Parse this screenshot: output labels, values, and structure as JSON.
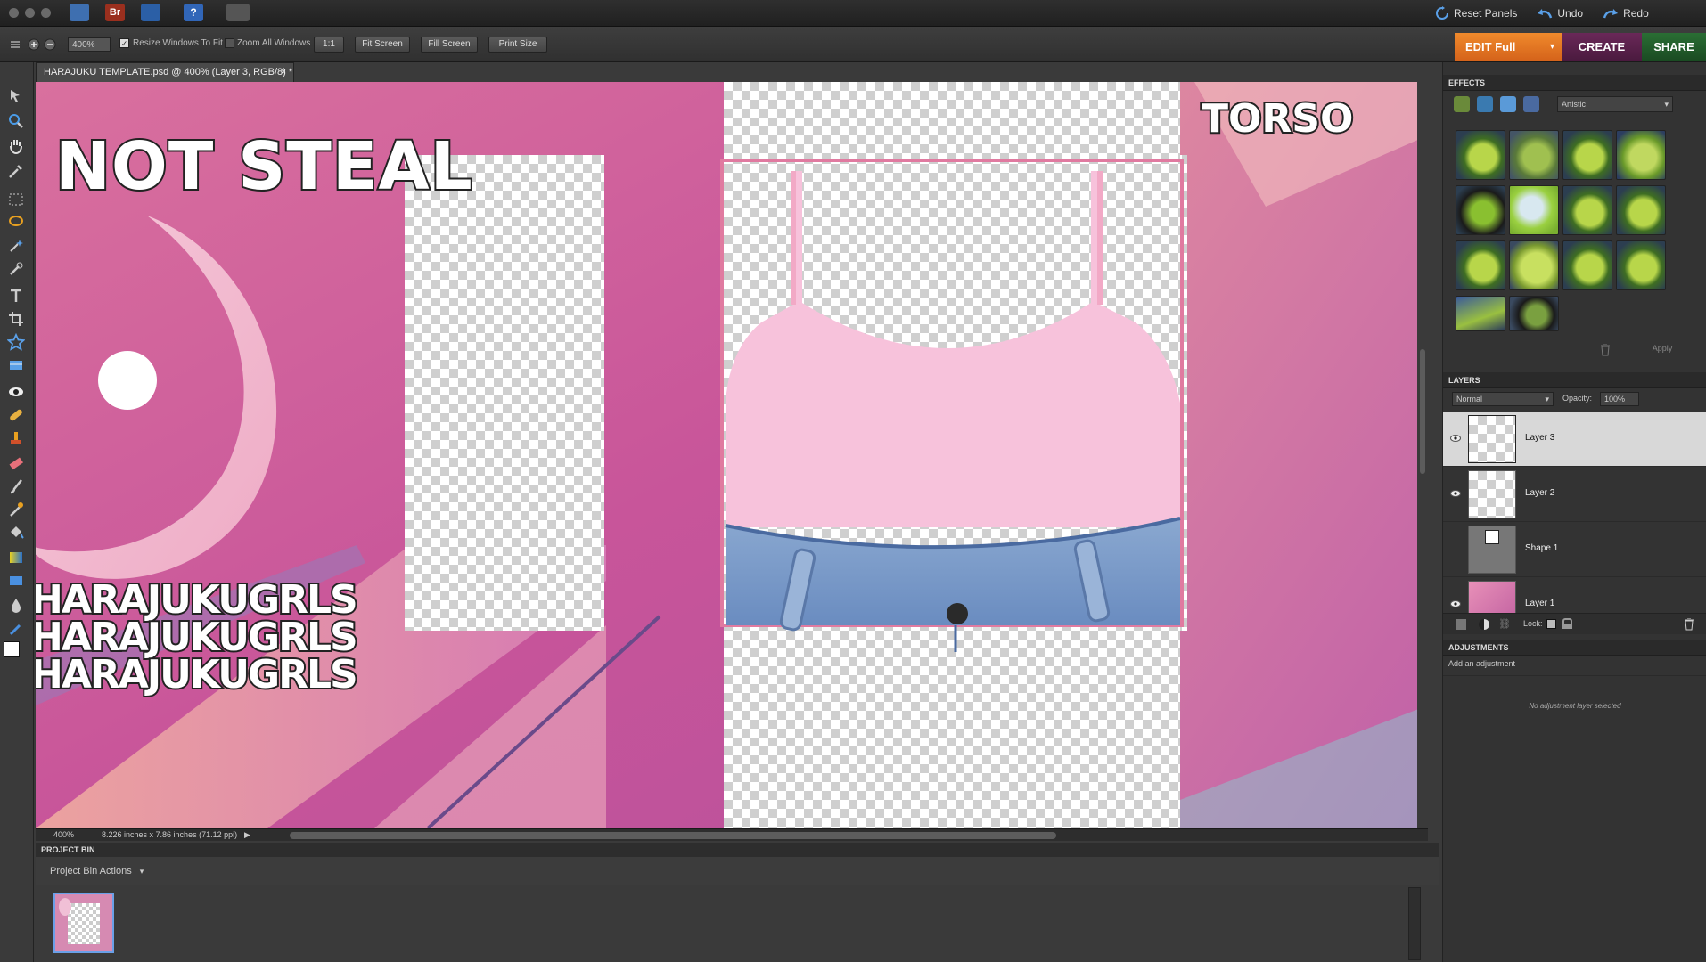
{
  "app": {
    "reset_panels": "Reset Panels",
    "undo": "Undo",
    "redo": "Redo"
  },
  "options": {
    "zoom_value": "400%",
    "resize_windows": "Resize Windows To Fit",
    "zoom_all_windows": "Zoom All Windows",
    "one_to_one": "1:1",
    "fit_screen": "Fit Screen",
    "fill_screen": "Fill Screen",
    "print_size": "Print Size"
  },
  "modes": {
    "edit_full": "EDIT Full",
    "create": "CREATE",
    "share": "SHARE"
  },
  "document": {
    "tab_title": "HARAJUKU TEMPLATE.psd @ 400% (Layer 3, RGB/8) *",
    "close": "×"
  },
  "canvas_text": {
    "not_steal": "NOT STEAL",
    "torso": "TORSO",
    "harajuku": [
      "HARAJUKUGRLS",
      "HARAJUKUGRLS",
      "HARAJUKUGRLS"
    ]
  },
  "status": {
    "zoom": "400%",
    "doc_size": "8.226 inches x 7.86 inches (71.12 ppi)"
  },
  "project_bin": {
    "title": "PROJECT BIN",
    "actions": "Project Bin Actions"
  },
  "effects": {
    "title": "EFFECTS",
    "category": "Artistic",
    "apply": "Apply"
  },
  "layers": {
    "title": "LAYERS",
    "blend_mode": "Normal",
    "opacity_label": "Opacity:",
    "opacity_value": "100%",
    "lock_label": "Lock:",
    "items": [
      {
        "name": "Layer 3",
        "visible": true,
        "selected": true
      },
      {
        "name": "Layer 2",
        "visible": true,
        "selected": false
      },
      {
        "name": "Shape 1",
        "visible": false,
        "selected": false
      },
      {
        "name": "Layer 1",
        "visible": true,
        "selected": false
      }
    ]
  },
  "adjustments": {
    "title": "ADJUSTMENTS",
    "add": "Add an adjustment",
    "none": "No adjustment layer selected"
  },
  "colors": {
    "edit_tab": "#e0731f",
    "create_tab": "#5a1e4a",
    "share_tab": "#1f5a2a",
    "canvas_pink": "#d56aa0"
  }
}
